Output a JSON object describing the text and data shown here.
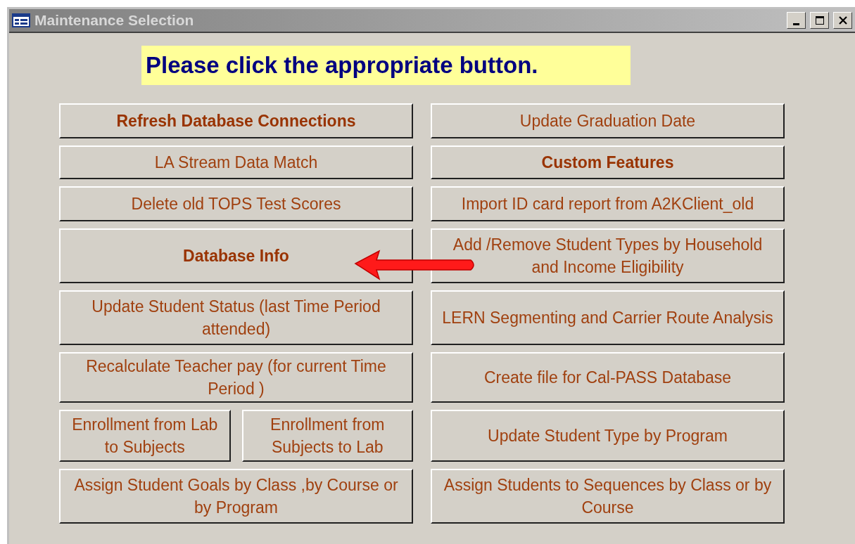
{
  "window": {
    "title": "Maintenance Selection"
  },
  "prompt": "Please click the appropriate button.",
  "rows": [
    {
      "left": [
        {
          "label": "Refresh Database Connections",
          "bold": true
        }
      ],
      "right": [
        {
          "label": "Update Graduation Date",
          "bold": false
        }
      ]
    },
    {
      "left": [
        {
          "label": "LA Stream Data Match",
          "bold": false
        }
      ],
      "right": [
        {
          "label": "Custom Features",
          "bold": true
        }
      ]
    },
    {
      "left": [
        {
          "label": "Delete old TOPS Test Scores",
          "bold": false
        }
      ],
      "right": [
        {
          "label": "Import ID card report from A2KClient_old",
          "bold": false
        }
      ]
    },
    {
      "left": [
        {
          "label": "Database Info",
          "bold": true
        }
      ],
      "right": [
        {
          "label": "Add /Remove Student Types by Household and Income Eligibility",
          "bold": false
        }
      ]
    },
    {
      "left": [
        {
          "label": "Update Student Status (last Time Period attended)",
          "bold": false
        }
      ],
      "right": [
        {
          "label": "LERN Segmenting and Carrier Route Analysis",
          "bold": false
        }
      ]
    },
    {
      "left": [
        {
          "label": "Recalculate Teacher pay (for current Time Period )",
          "bold": false
        }
      ],
      "right": [
        {
          "label": "Create file for Cal-PASS Database",
          "bold": false
        }
      ]
    },
    {
      "left": [
        {
          "label": "Enrollment from Lab to Subjects",
          "bold": false
        },
        {
          "label": "Enrollment from Subjects to Lab",
          "bold": false
        }
      ],
      "right": [
        {
          "label": "Update Student Type by Program",
          "bold": false
        }
      ]
    },
    {
      "left": [
        {
          "label": "Assign Student Goals  by Class ,by Course or by Program",
          "bold": false
        }
      ],
      "right": [
        {
          "label": "Assign Students to Sequences by Class or by Course",
          "bold": false
        }
      ]
    }
  ]
}
